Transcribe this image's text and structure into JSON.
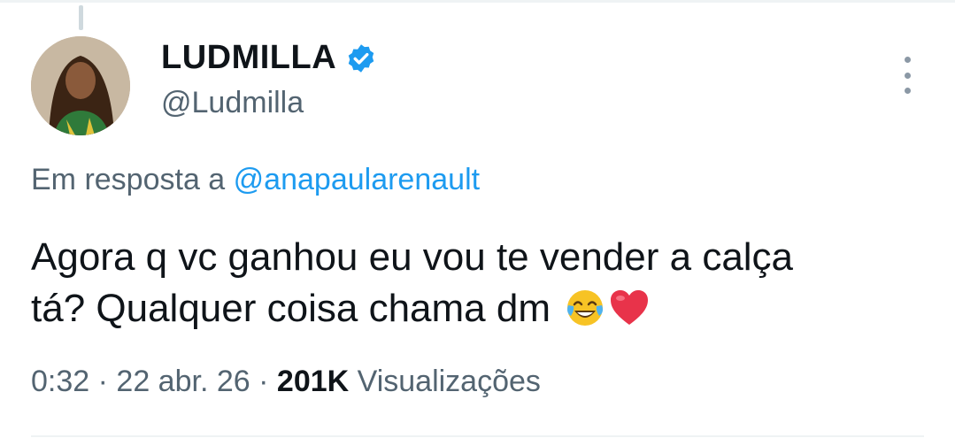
{
  "tweet": {
    "display_name": "LUDMILLA",
    "handle": "@Ludmilla",
    "reply_prefix": "Em resposta a",
    "reply_to": "@anapaularenault",
    "text_line1": "Agora q vc ganhou eu vou te vender a calça",
    "text_line2": "tá? Qualquer coisa chama dm",
    "emojis": [
      "laughing-crying-emoji",
      "red-heart-emoji"
    ],
    "time": "0:32",
    "separator": "·",
    "date": "22 abr. 26",
    "views_count": "201K",
    "views_label": "Visualizações"
  },
  "colors": {
    "text": "#0f1419",
    "secondary": "#536471",
    "link": "#1d9bf0",
    "verified": "#1d9bf0"
  }
}
